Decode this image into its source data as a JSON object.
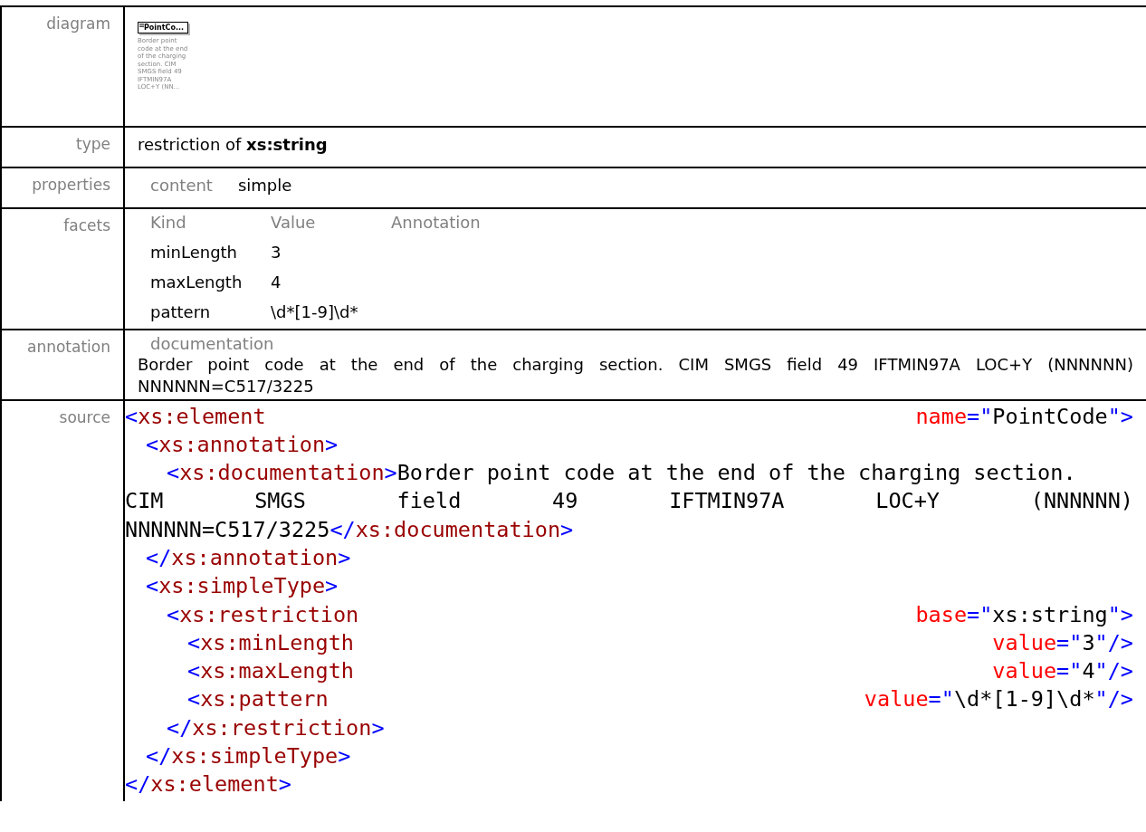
{
  "diagram": {
    "label": "diagram",
    "node_title": "PointCo...",
    "node_note": [
      "Border point",
      "code at the end",
      "of the charging",
      "section. CIM",
      "SMGS field 49",
      "IFTMIN97A",
      "LOC+Y (NN..."
    ]
  },
  "type": {
    "label": "type",
    "value": "restriction of **xs:string**"
  },
  "properties": {
    "label": "properties",
    "items": [
      {
        "key": "content",
        "value": "simple"
      }
    ]
  },
  "facets": {
    "label": "facets",
    "columns": [
      "Kind",
      "Value",
      "Annotation"
    ],
    "rows": [
      {
        "kind": "minLength",
        "value": "3"
      },
      {
        "kind": "maxLength",
        "value": "4"
      },
      {
        "kind": "pattern",
        "value": "\\d*[1-9]\\d*"
      }
    ]
  },
  "annotation": {
    "label": "annotation",
    "heading": "documentation",
    "text": "Border point code at the end of the charging section. CIM SMGS field 49 IFTMIN97A LOC+Y (NNNNNN) NNNNNN=C517/3225"
  },
  "source": {
    "label": "source",
    "lines": [
      {
        "groups": [
          [
            {
              "kind": "bracket",
              "text": "<"
            },
            {
              "kind": "tag",
              "text": "xs:element"
            }
          ],
          [
            {
              "kind": "attr",
              "text": "name"
            },
            {
              "kind": "bracket",
              "text": "=\""
            },
            {
              "kind": "text",
              "text": "PointCode"
            },
            {
              "kind": "bracket",
              "text": "\">"
            }
          ]
        ],
        "children": [
          {
            "groups": [
              [
                {
                  "kind": "bracket",
                  "text": "<"
                },
                {
                  "kind": "tag",
                  "text": "xs:annotation"
                },
                {
                  "kind": "bracket",
                  "text": ">"
                }
              ]
            ],
            "children": [
              {
                "groups": [
                  [
                    {
                      "kind": "bracket",
                      "text": "<"
                    },
                    {
                      "kind": "tag",
                      "text": "xs:documentation"
                    },
                    {
                      "kind": "bracket",
                      "text": ">"
                    },
                    {
                      "kind": "text",
                      "text": "Border point code at the end of the charging section."
                    }
                  ]
                ],
                "continued": [
                  {
                    "groups": [
                      [
                        {
                          "kind": "text",
                          "text": "CIM"
                        }
                      ],
                      [
                        {
                          "kind": "text",
                          "text": "SMGS"
                        }
                      ],
                      [
                        {
                          "kind": "text",
                          "text": "field"
                        }
                      ],
                      [
                        {
                          "kind": "text",
                          "text": "49"
                        }
                      ],
                      [
                        {
                          "kind": "text",
                          "text": "IFTMIN97A"
                        }
                      ],
                      [
                        {
                          "kind": "text",
                          "text": "LOC+Y"
                        }
                      ],
                      [
                        {
                          "kind": "text",
                          "text": "(NNNNNN)"
                        }
                      ]
                    ]
                  },
                  {
                    "groups": [
                      [
                        {
                          "kind": "text",
                          "text": "NNNNNN=C517/3225"
                        },
                        {
                          "kind": "bracket",
                          "text": "</"
                        },
                        {
                          "kind": "tag",
                          "text": "xs:documentation"
                        },
                        {
                          "kind": "bracket",
                          "text": ">"
                        }
                      ]
                    ]
                  }
                ]
              }
            ]
          },
          {
            "groups": [
              [
                {
                  "kind": "bracket",
                  "text": "</"
                },
                {
                  "kind": "tag",
                  "text": "xs:annotation"
                },
                {
                  "kind": "bracket",
                  "text": ">"
                }
              ]
            ]
          },
          {
            "groups": [
              [
                {
                  "kind": "bracket",
                  "text": "<"
                },
                {
                  "kind": "tag",
                  "text": "xs:simpleType"
                },
                {
                  "kind": "bracket",
                  "text": ">"
                }
              ]
            ],
            "children": [
              {
                "groups": [
                  [
                    {
                      "kind": "bracket",
                      "text": "<"
                    },
                    {
                      "kind": "tag",
                      "text": "xs:restriction"
                    }
                  ],
                  [
                    {
                      "kind": "attr",
                      "text": "base"
                    },
                    {
                      "kind": "bracket",
                      "text": "=\""
                    },
                    {
                      "kind": "text",
                      "text": "xs:string"
                    },
                    {
                      "kind": "bracket",
                      "text": "\">"
                    }
                  ]
                ],
                "children": [
                  {
                    "groups": [
                      [
                        {
                          "kind": "bracket",
                          "text": "<"
                        },
                        {
                          "kind": "tag",
                          "text": "xs:minLength"
                        }
                      ],
                      [
                        {
                          "kind": "attr",
                          "text": "value"
                        },
                        {
                          "kind": "bracket",
                          "text": "=\""
                        },
                        {
                          "kind": "text",
                          "text": "3"
                        },
                        {
                          "kind": "bracket",
                          "text": "\"/>"
                        }
                      ]
                    ]
                  },
                  {
                    "groups": [
                      [
                        {
                          "kind": "bracket",
                          "text": "<"
                        },
                        {
                          "kind": "tag",
                          "text": "xs:maxLength"
                        }
                      ],
                      [
                        {
                          "kind": "attr",
                          "text": "value"
                        },
                        {
                          "kind": "bracket",
                          "text": "=\""
                        },
                        {
                          "kind": "text",
                          "text": "4"
                        },
                        {
                          "kind": "bracket",
                          "text": "\"/>"
                        }
                      ]
                    ]
                  },
                  {
                    "groups": [
                      [
                        {
                          "kind": "bracket",
                          "text": "<"
                        },
                        {
                          "kind": "tag",
                          "text": "xs:pattern"
                        }
                      ],
                      [
                        {
                          "kind": "attr",
                          "text": "value"
                        },
                        {
                          "kind": "bracket",
                          "text": "=\""
                        },
                        {
                          "kind": "text",
                          "text": "\\d*[1-9]\\d*"
                        },
                        {
                          "kind": "bracket",
                          "text": "\"/>"
                        }
                      ]
                    ]
                  }
                ]
              },
              {
                "groups": [
                  [
                    {
                      "kind": "bracket",
                      "text": "</"
                    },
                    {
                      "kind": "tag",
                      "text": "xs:restriction"
                    },
                    {
                      "kind": "bracket",
                      "text": ">"
                    }
                  ]
                ]
              }
            ]
          },
          {
            "groups": [
              [
                {
                  "kind": "bracket",
                  "text": "</"
                },
                {
                  "kind": "tag",
                  "text": "xs:simpleType"
                },
                {
                  "kind": "bracket",
                  "text": ">"
                }
              ]
            ]
          }
        ]
      },
      {
        "groups": [
          [
            {
              "kind": "bracket",
              "text": "</"
            },
            {
              "kind": "tag",
              "text": "xs:element"
            },
            {
              "kind": "bracket",
              "text": ">"
            }
          ]
        ]
      }
    ]
  }
}
